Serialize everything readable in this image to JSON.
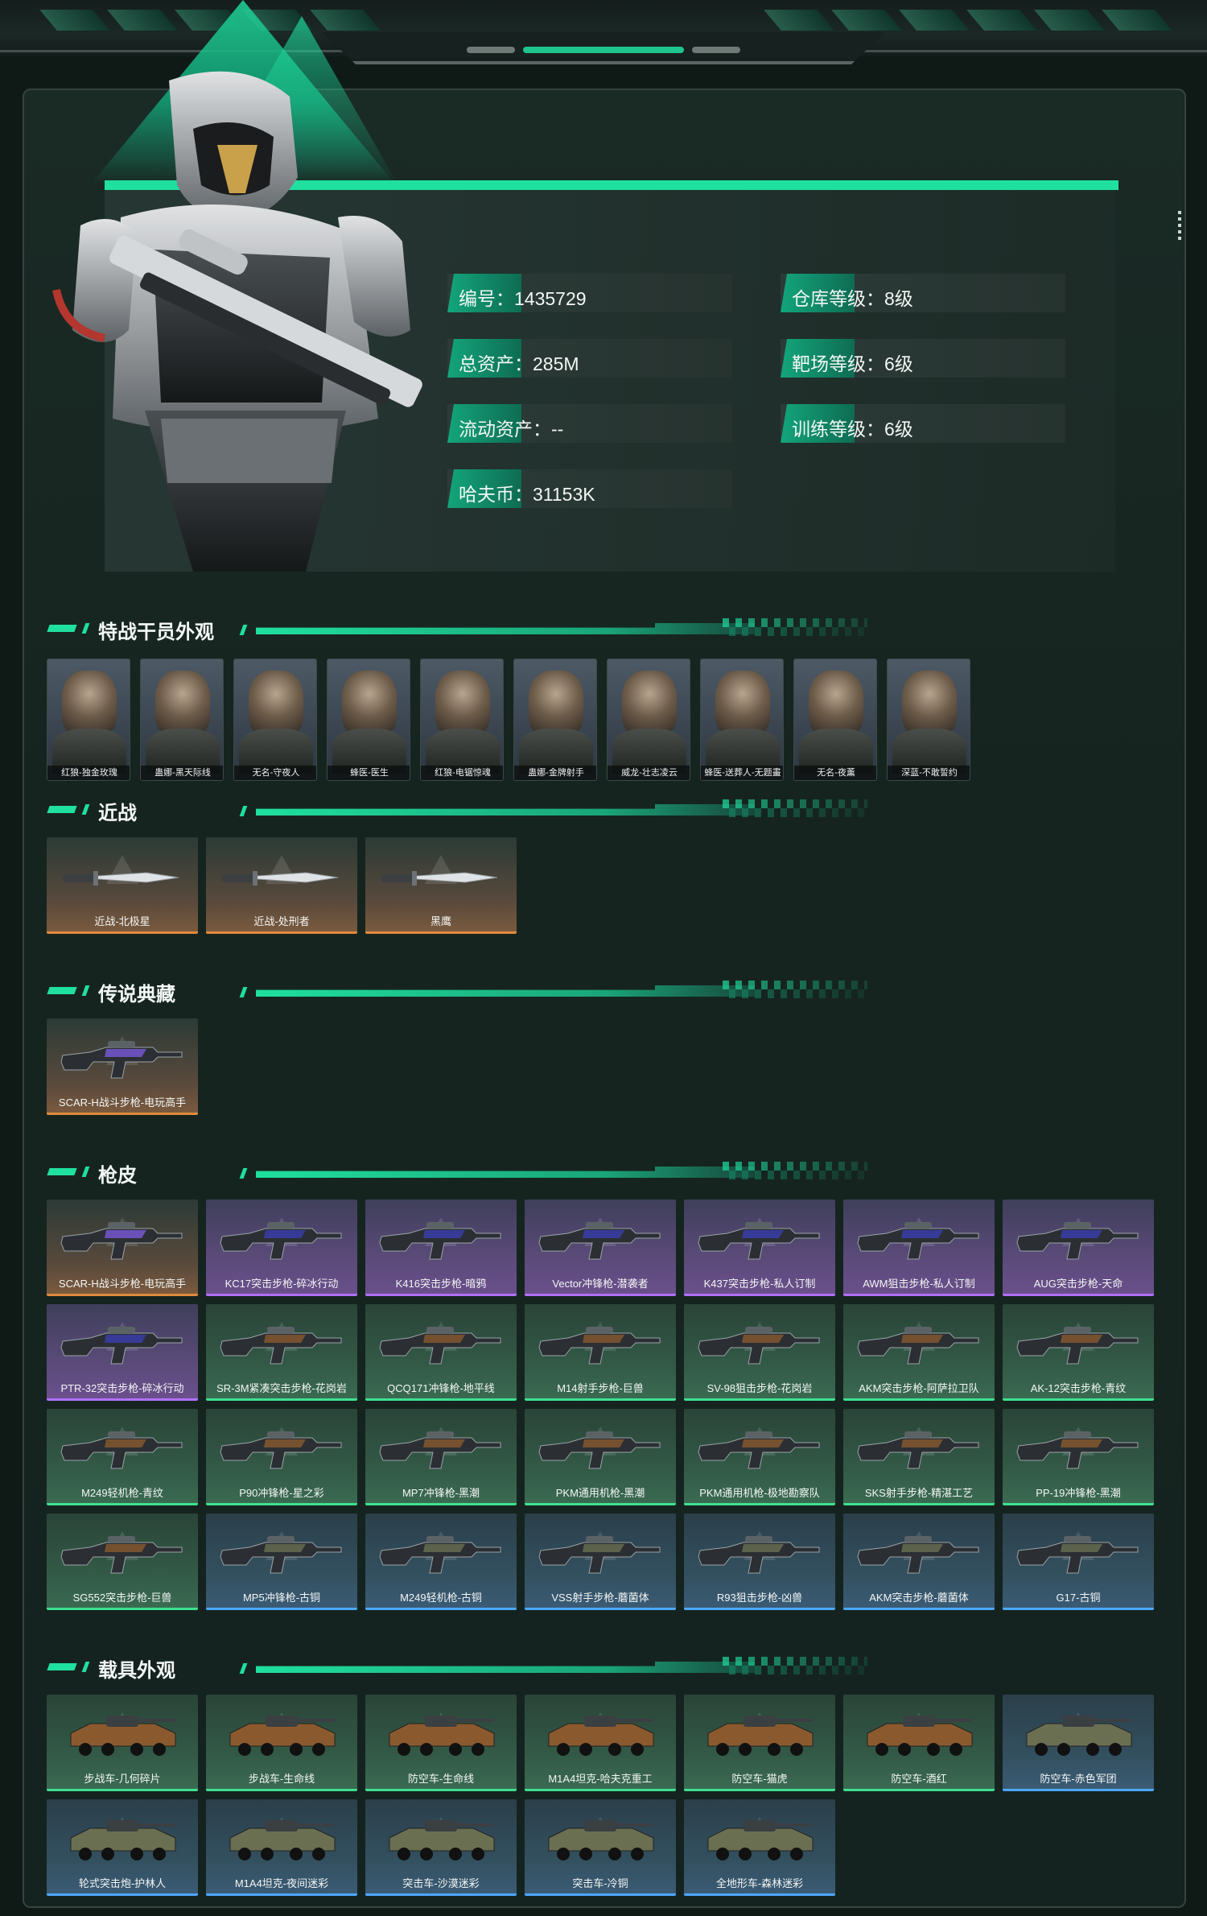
{
  "profile": {
    "fields": [
      {
        "label": "编号：",
        "value": "1435729"
      },
      {
        "label": "仓库等级：",
        "value": "8级"
      },
      {
        "label": "总资产：",
        "value": "285M"
      },
      {
        "label": "靶场等级：",
        "value": "6级"
      },
      {
        "label": "流动资产：",
        "value": "--"
      },
      {
        "label": "训练等级：",
        "value": "6级"
      },
      {
        "label": "哈夫币：",
        "value": "31153K"
      }
    ]
  },
  "sections": {
    "operators": "特战干员外观",
    "melee": "近战",
    "legendary": "传说典藏",
    "skins": "枪皮",
    "vehicles": "载具外观"
  },
  "operators": [
    "红狼-独金玫瑰",
    "蛊娜-黑天际线",
    "无名-守夜人",
    "蜂医-医生",
    "红狼-电锯惊魂",
    "蛊娜-金牌射手",
    "威龙-壮志凌云",
    "蜂医-送葬人-无题畫",
    "无名-夜薰",
    "深蓝-不敢誓约"
  ],
  "melee": [
    {
      "label": "近战-北极星",
      "rarity": "orange"
    },
    {
      "label": "近战-处刑者",
      "rarity": "orange"
    },
    {
      "label": "黑鹰",
      "rarity": "orange"
    }
  ],
  "legendary": [
    {
      "label": "SCAR-H战斗步枪-电玩高手",
      "rarity": "orange"
    }
  ],
  "skins": [
    {
      "label": "SCAR-H战斗步枪-电玩高手",
      "rarity": "orange"
    },
    {
      "label": "KC17突击步枪-碎冰行动",
      "rarity": "purple"
    },
    {
      "label": "K416突击步枪-暗鸦",
      "rarity": "purple"
    },
    {
      "label": "Vector冲锋枪-潜袭者",
      "rarity": "purple"
    },
    {
      "label": "K437突击步枪-私人订制",
      "rarity": "purple"
    },
    {
      "label": "AWM狙击步枪-私人订制",
      "rarity": "purple"
    },
    {
      "label": "AUG突击步枪-天命",
      "rarity": "purple"
    },
    {
      "label": "PTR-32突击步枪-碎冰行动",
      "rarity": "purple"
    },
    {
      "label": "SR-3M紧凑突击步枪-花岗岩",
      "rarity": "green"
    },
    {
      "label": "QCQ171冲锋枪-地平线",
      "rarity": "green"
    },
    {
      "label": "M14射手步枪-巨兽",
      "rarity": "green"
    },
    {
      "label": "SV-98狙击步枪-花岗岩",
      "rarity": "green"
    },
    {
      "label": "AKM突击步枪-阿萨拉卫队",
      "rarity": "green"
    },
    {
      "label": "AK-12突击步枪-青纹",
      "rarity": "green"
    },
    {
      "label": "M249轻机枪-青纹",
      "rarity": "green"
    },
    {
      "label": "P90冲锋枪-星之彩",
      "rarity": "green"
    },
    {
      "label": "MP7冲锋枪-黑潮",
      "rarity": "green"
    },
    {
      "label": "PKM通用机枪-黑潮",
      "rarity": "green"
    },
    {
      "label": "PKM通用机枪-极地勘察队",
      "rarity": "green"
    },
    {
      "label": "SKS射手步枪-精湛工艺",
      "rarity": "green"
    },
    {
      "label": "PP-19冲锋枪-黑潮",
      "rarity": "green"
    },
    {
      "label": "SG552突击步枪-巨兽",
      "rarity": "green"
    },
    {
      "label": "MP5冲锋枪-古铜",
      "rarity": "blue"
    },
    {
      "label": "M249轻机枪-古铜",
      "rarity": "blue"
    },
    {
      "label": "VSS射手步枪-蘑菌体",
      "rarity": "blue"
    },
    {
      "label": "R93狙击步枪-凶兽",
      "rarity": "blue"
    },
    {
      "label": "AKM突击步枪-蘑菌体",
      "rarity": "blue"
    },
    {
      "label": "G17-古铜",
      "rarity": "blue"
    }
  ],
  "vehicles": [
    {
      "label": "步战车-几何碎片",
      "rarity": "green"
    },
    {
      "label": "步战车-生命线",
      "rarity": "green"
    },
    {
      "label": "防空车-生命线",
      "rarity": "green"
    },
    {
      "label": "M1A4坦克-哈夫克重工",
      "rarity": "green"
    },
    {
      "label": "防空车-猫虎",
      "rarity": "green"
    },
    {
      "label": "防空车-酒红",
      "rarity": "green"
    },
    {
      "label": "防空车-赤色军团",
      "rarity": "blue"
    },
    {
      "label": "轮式突击炮-护林人",
      "rarity": "blue"
    },
    {
      "label": "M1A4坦克-夜间迷彩",
      "rarity": "blue"
    },
    {
      "label": "突击车-沙漠迷彩",
      "rarity": "blue"
    },
    {
      "label": "突击车-冷铜",
      "rarity": "blue"
    },
    {
      "label": "全地形车-森林迷彩",
      "rarity": "blue"
    }
  ],
  "colors": {
    "accent": "#1fe09e",
    "orange": "#e08a3c",
    "purple": "#b070ff",
    "green": "#3ee08f",
    "blue": "#4da8ff"
  }
}
